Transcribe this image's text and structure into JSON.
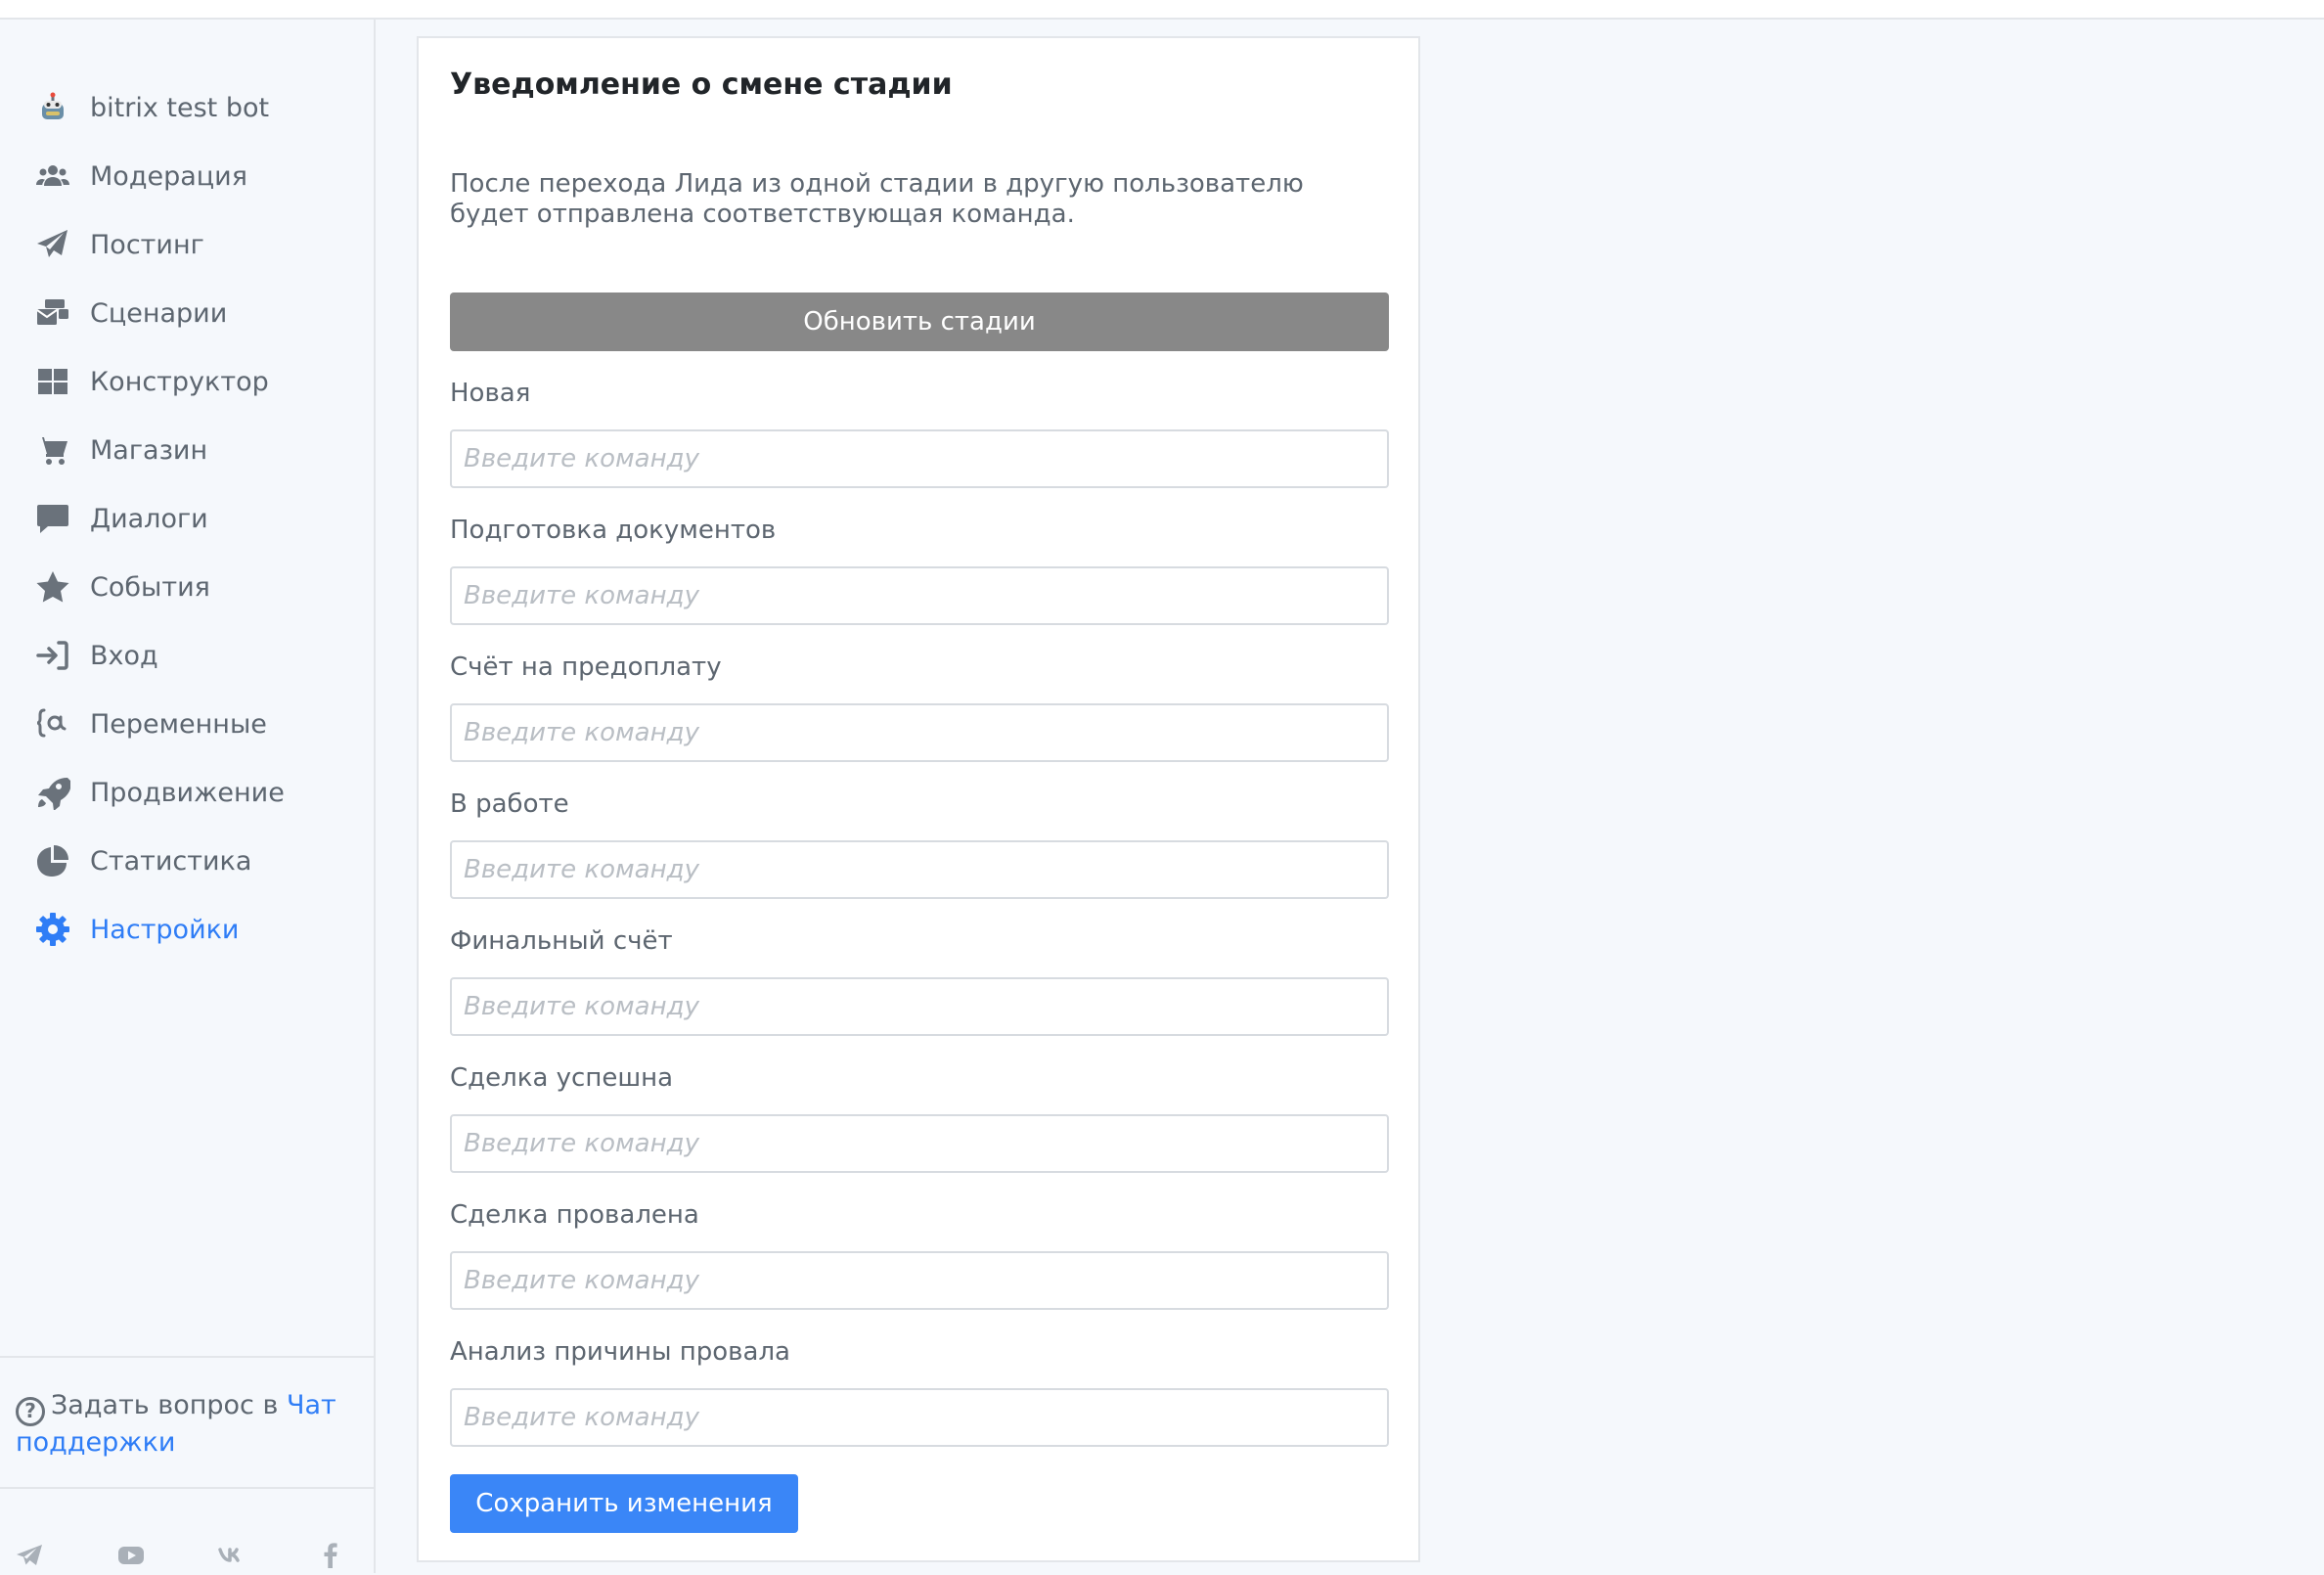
{
  "colors": {
    "accent": "#2f7df6",
    "text_muted": "#5d6670",
    "update_button_bg": "#888888",
    "save_button_bg": "#3a86f7"
  },
  "sidebar": {
    "items": [
      {
        "label": "bitrix test bot",
        "icon": "bot-icon",
        "active": false
      },
      {
        "label": "Модерация",
        "icon": "users-icon",
        "active": false
      },
      {
        "label": "Постинг",
        "icon": "paper-plane-icon",
        "active": false
      },
      {
        "label": "Сценарии",
        "icon": "mail-bulk-icon",
        "active": false
      },
      {
        "label": "Конструктор",
        "icon": "grid-icon",
        "active": false
      },
      {
        "label": "Магазин",
        "icon": "cart-icon",
        "active": false
      },
      {
        "label": "Диалоги",
        "icon": "chat-bubble-icon",
        "active": false
      },
      {
        "label": "События",
        "icon": "star-icon",
        "active": false
      },
      {
        "label": "Вход",
        "icon": "sign-in-icon",
        "active": false
      },
      {
        "label": "Переменные",
        "icon": "variable-icon",
        "active": false
      },
      {
        "label": "Продвижение",
        "icon": "rocket-icon",
        "active": false
      },
      {
        "label": "Статистика",
        "icon": "pie-chart-icon",
        "active": false
      },
      {
        "label": "Настройки",
        "icon": "gear-icon",
        "active": true
      }
    ],
    "support": {
      "prefix": "Задать вопрос в ",
      "link_label": "Чат поддержки"
    },
    "socials": [
      "telegram-icon",
      "youtube-icon",
      "vk-icon",
      "facebook-icon"
    ]
  },
  "card": {
    "title": "Уведомление о смене стадии",
    "description": "После перехода Лида из одной стадии в другую пользователю будет отправлена соответствующая команда.",
    "update_button_label": "Обновить стадии",
    "input_placeholder": "Введите команду",
    "fields": [
      {
        "label": "Новая",
        "value": ""
      },
      {
        "label": "Подготовка документов",
        "value": ""
      },
      {
        "label": "Счёт на предоплату",
        "value": ""
      },
      {
        "label": "В работе",
        "value": ""
      },
      {
        "label": "Финальный счёт",
        "value": ""
      },
      {
        "label": "Сделка успешна",
        "value": ""
      },
      {
        "label": "Сделка провалена",
        "value": ""
      },
      {
        "label": "Анализ причины провала",
        "value": ""
      }
    ],
    "save_button_label": "Сохранить изменения"
  }
}
